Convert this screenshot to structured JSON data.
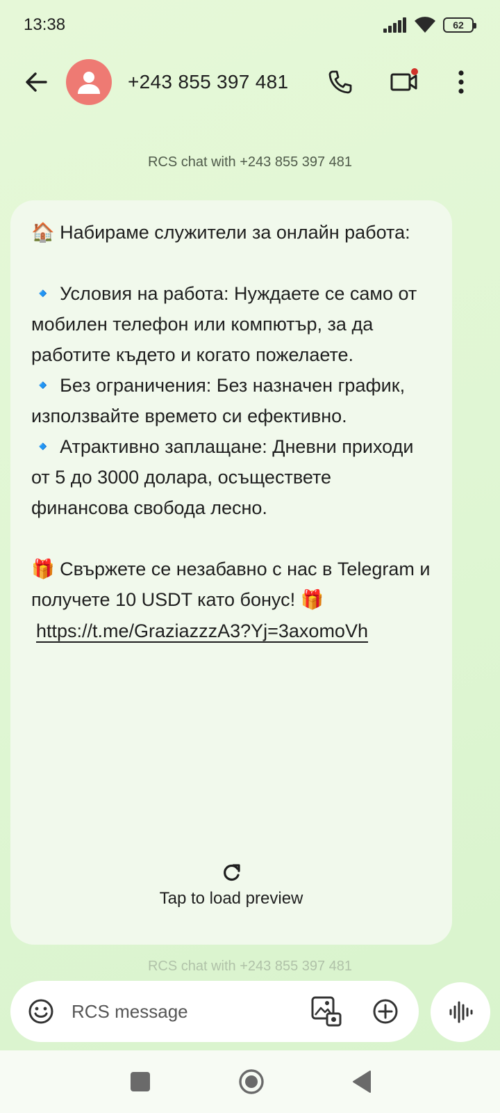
{
  "status": {
    "time": "13:38",
    "battery": "62"
  },
  "header": {
    "contact": "+243 855 397 481"
  },
  "chat": {
    "rcs_notice": "RCS chat with +243 855 397 481",
    "faded_notice": "RCS chat with +243 855 397 481"
  },
  "message": {
    "text": "🏠 Набираме служители за онлайн работа:\n\n🔹 Условия на работа: Нуждаете се само от мобилен телефон или компютър, за да работите където и когато пожелаете.\n🔹 Без ограничения: Без назначен график, използвайте времето си ефективно.\n🔹 Атрактивно заплащане: Дневни приходи от 5 до 3000 долара, осъществете финансова свобода лесно.\n\n🎁 Свържете се незабавно с нас в Telegram и получете 10 USDT като бонус! 🎁",
    "link": "https://t.me/GraziazzzA3?Yj=3axomoVh",
    "preview_label": "Tap to load preview"
  },
  "composer": {
    "placeholder": "RCS message"
  },
  "icons": {
    "back": "arrow-left-icon",
    "avatar": "person-icon",
    "call": "phone-icon",
    "video": "video-camera-icon",
    "more": "more-vert-icon",
    "refresh": "refresh-icon",
    "emoji": "emoji-icon",
    "gallery": "gallery-icon",
    "add": "add-circle-icon",
    "voice": "voice-wave-icon"
  },
  "colors": {
    "background": "#e3f7d6",
    "bubble": "#f1f9ec",
    "avatar": "#ee7a73",
    "notification_dot": "#d0332a"
  }
}
